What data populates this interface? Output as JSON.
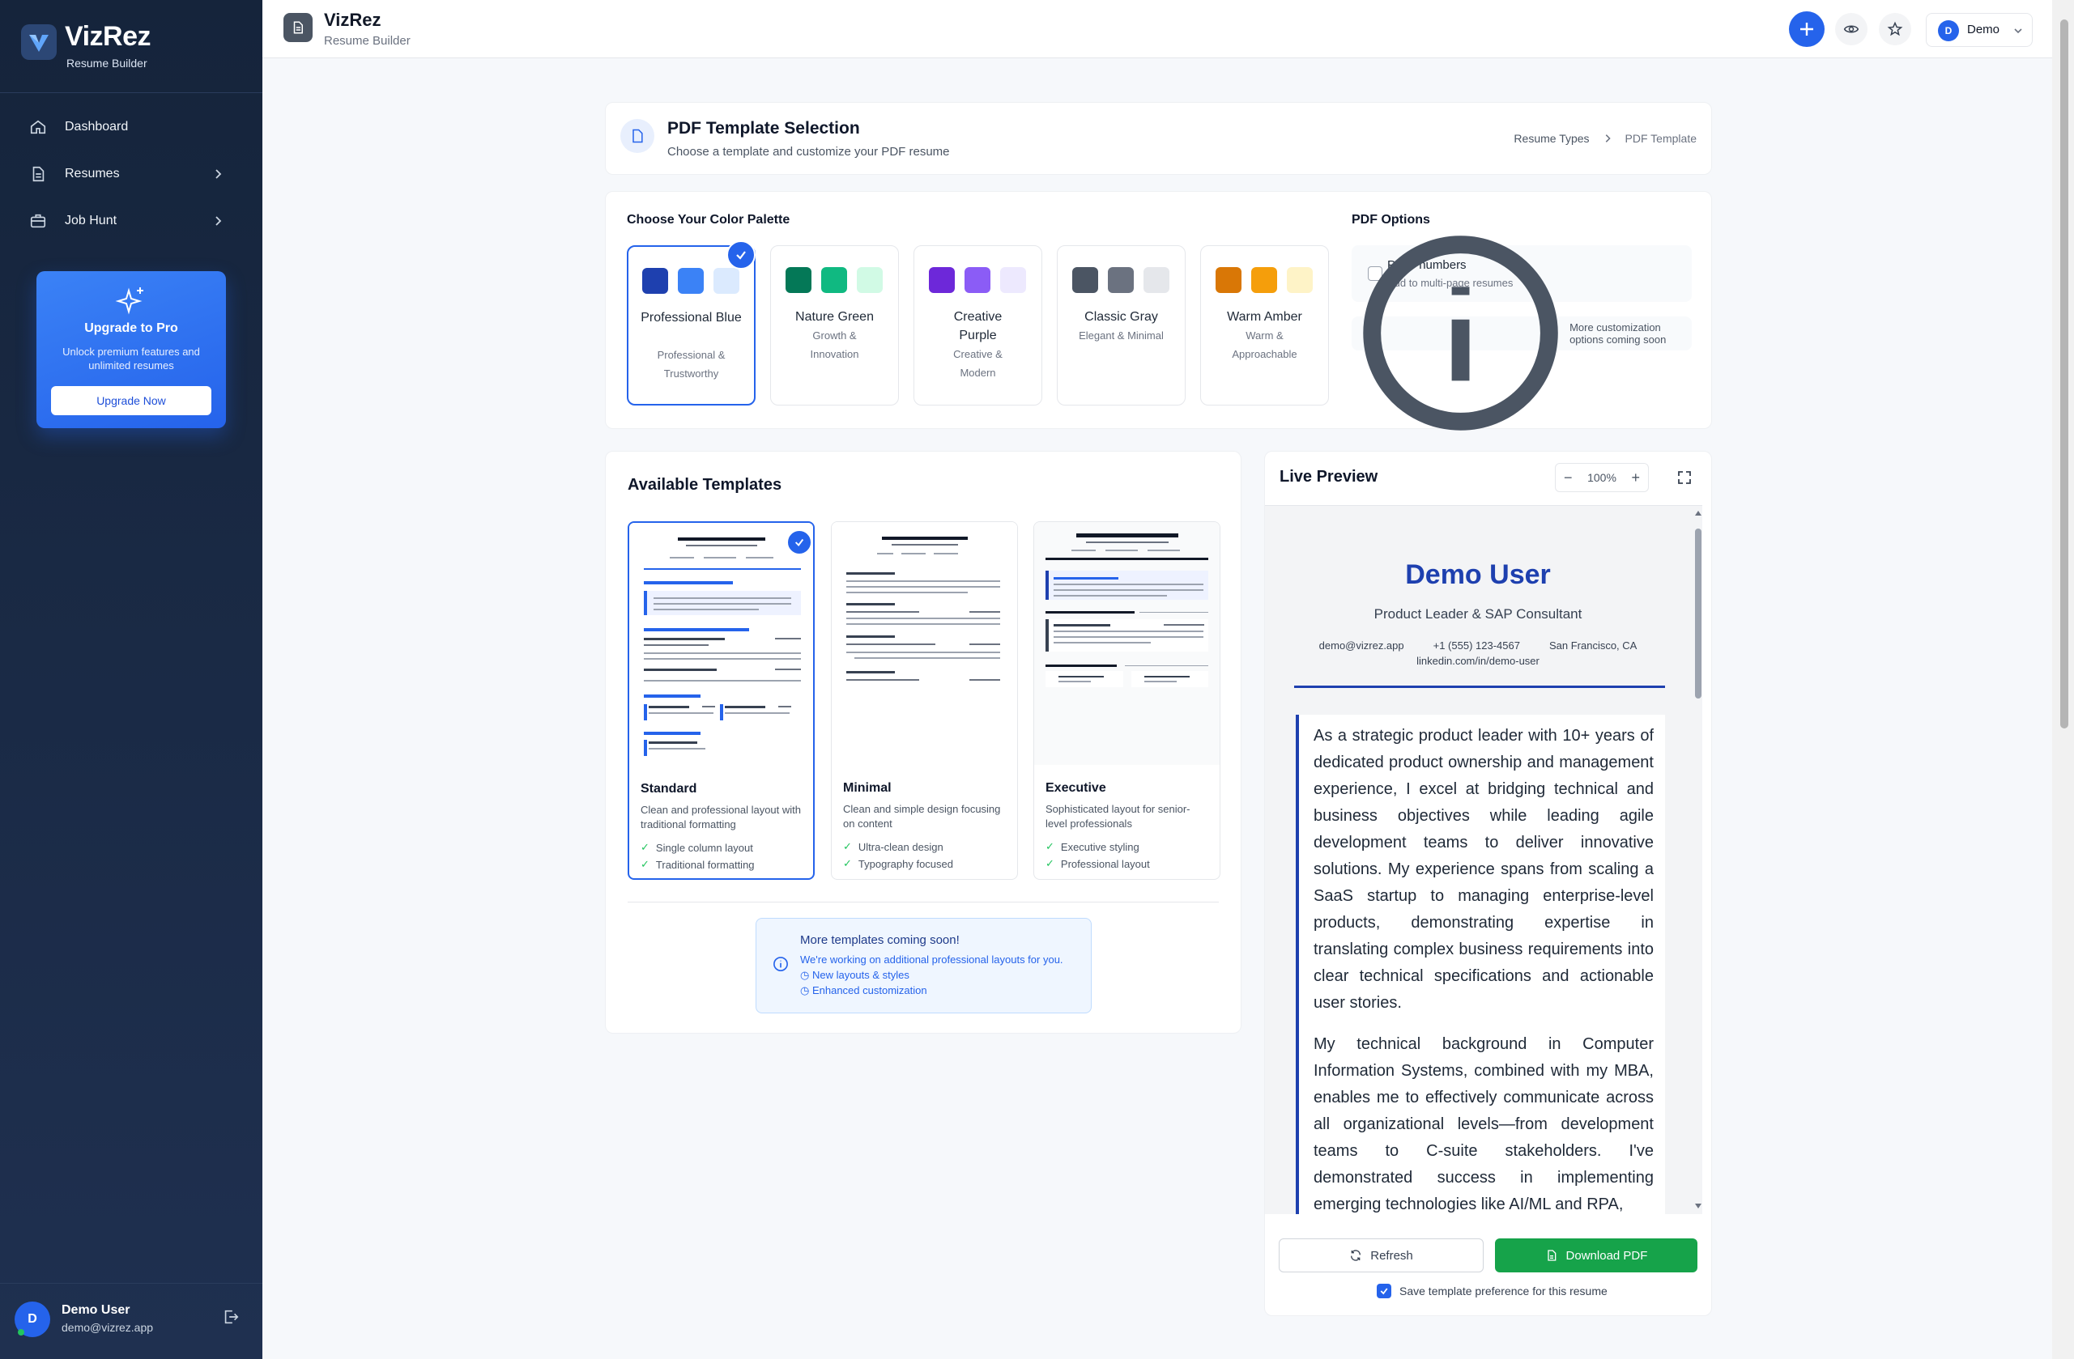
{
  "sidebar": {
    "brand": "VizRez",
    "brand_sub": "Resume Builder",
    "nav": [
      {
        "label": "Dashboard"
      },
      {
        "label": "Resumes"
      },
      {
        "label": "Job Hunt"
      }
    ],
    "promo": {
      "title": "Upgrade to Pro",
      "text": "Unlock premium features and unlimited resumes",
      "button": "Upgrade Now"
    },
    "user": {
      "initial": "D",
      "name": "Demo User",
      "email": "demo@vizrez.app"
    }
  },
  "topbar": {
    "title": "VizRez",
    "subtitle": "Resume Builder",
    "user_initial": "D",
    "user_name": "Demo"
  },
  "header": {
    "title": "PDF Template Selection",
    "subtitle": "Choose a template and customize your PDF resume",
    "breadcrumb": [
      "Resume Types",
      "PDF Template"
    ]
  },
  "palette": {
    "title": "Choose Your Color Palette",
    "items": [
      {
        "name": "Professional Blue",
        "desc": "Professional & Trustworthy",
        "colors": [
          "#1e40af",
          "#3b82f6",
          "#dbeafe"
        ]
      },
      {
        "name": "Nature Green",
        "desc": "Growth & Innovation",
        "colors": [
          "#047857",
          "#10b981",
          "#d1fae5"
        ]
      },
      {
        "name": "Creative Purple",
        "desc": "Creative & Modern",
        "colors": [
          "#6d28d9",
          "#8b5cf6",
          "#ede9fe"
        ]
      },
      {
        "name": "Classic Gray",
        "desc": "Elegant & Minimal",
        "colors": [
          "#4b5563",
          "#6b7280",
          "#e5e7eb"
        ]
      },
      {
        "name": "Warm Amber",
        "desc": "Warm & Approachable",
        "colors": [
          "#d97706",
          "#f59e0b",
          "#fef3c7"
        ]
      }
    ]
  },
  "options": {
    "title": "PDF Options",
    "page_numbers": "Page numbers",
    "page_numbers_sub": "Add to multi-page resumes",
    "note": "More customization options coming soon"
  },
  "templates": {
    "title": "Available Templates",
    "items": [
      {
        "name": "Standard",
        "desc": "Clean and professional layout with traditional formatting",
        "features": [
          "Single column layout",
          "Traditional formatting"
        ]
      },
      {
        "name": "Minimal",
        "desc": "Clean and simple design focusing on content",
        "features": [
          "Ultra-clean design",
          "Typography focused"
        ]
      },
      {
        "name": "Executive",
        "desc": "Sophisticated layout for senior-level professionals",
        "features": [
          "Executive styling",
          "Professional layout"
        ]
      }
    ],
    "more": {
      "title": "More templates coming soon!",
      "text": "We're working on additional professional layouts for you.",
      "items": [
        "New layouts & styles",
        "Enhanced customization"
      ]
    }
  },
  "preview": {
    "title": "Live Preview",
    "zoom": "100%",
    "name": "Demo User",
    "role": "Product Leader & SAP Consultant",
    "email": "demo@vizrez.app",
    "phone": "+1 (555) 123-4567",
    "location": "San Francisco, CA",
    "linkedin": "linkedin.com/in/demo-user",
    "summary": [
      "As a strategic product leader with 10+ years of dedicated product ownership and management experience, I excel at bridging technical and business objectives while leading agile development teams to deliver innovative solutions. My experience spans from scaling a SaaS startup to managing enterprise-level products, demonstrating expertise in translating complex business requirements into clear technical specifications and actionable user stories.",
      "My technical background in Computer Information Systems, combined with my MBA, enables me to effectively communicate across all organizational levels—from development teams to C-suite stakeholders. I've demonstrated success in implementing emerging technologies like AI/ML and RPA,"
    ],
    "refresh": "Refresh",
    "download": "Download PDF",
    "save_pref": "Save template preference for this resume"
  }
}
